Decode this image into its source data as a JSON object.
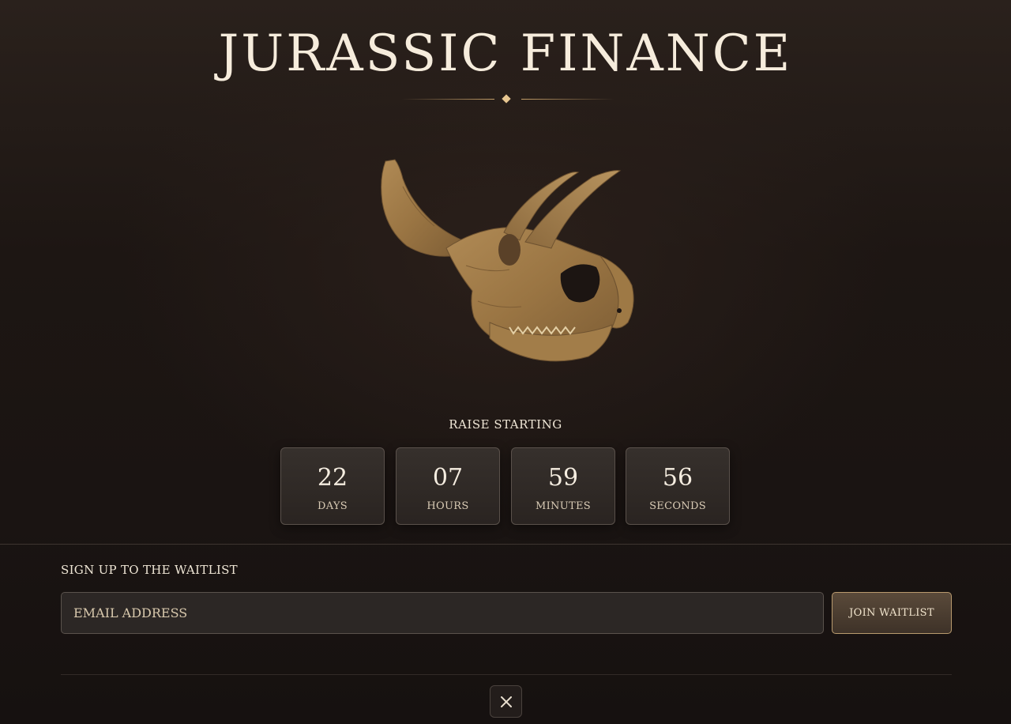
{
  "header": {
    "title": "JURASSIC FINANCE"
  },
  "hero": {
    "image": "triceratops-skull"
  },
  "countdown": {
    "label": "RAISE STARTING",
    "units": [
      {
        "value": "22",
        "label": "DAYS"
      },
      {
        "value": "07",
        "label": "HOURS"
      },
      {
        "value": "59",
        "label": "MINUTES"
      },
      {
        "value": "56",
        "label": "SECONDS"
      }
    ]
  },
  "waitlist": {
    "heading": "SIGN UP TO THE WAITLIST",
    "email_placeholder": "EMAIL ADDRESS",
    "button_label": "JOIN WAITLIST"
  },
  "footer": {
    "social_icon": "x-icon"
  },
  "colors": {
    "accent": "#c6a069",
    "title": "#f6ecdc",
    "background": "#1a1412"
  }
}
